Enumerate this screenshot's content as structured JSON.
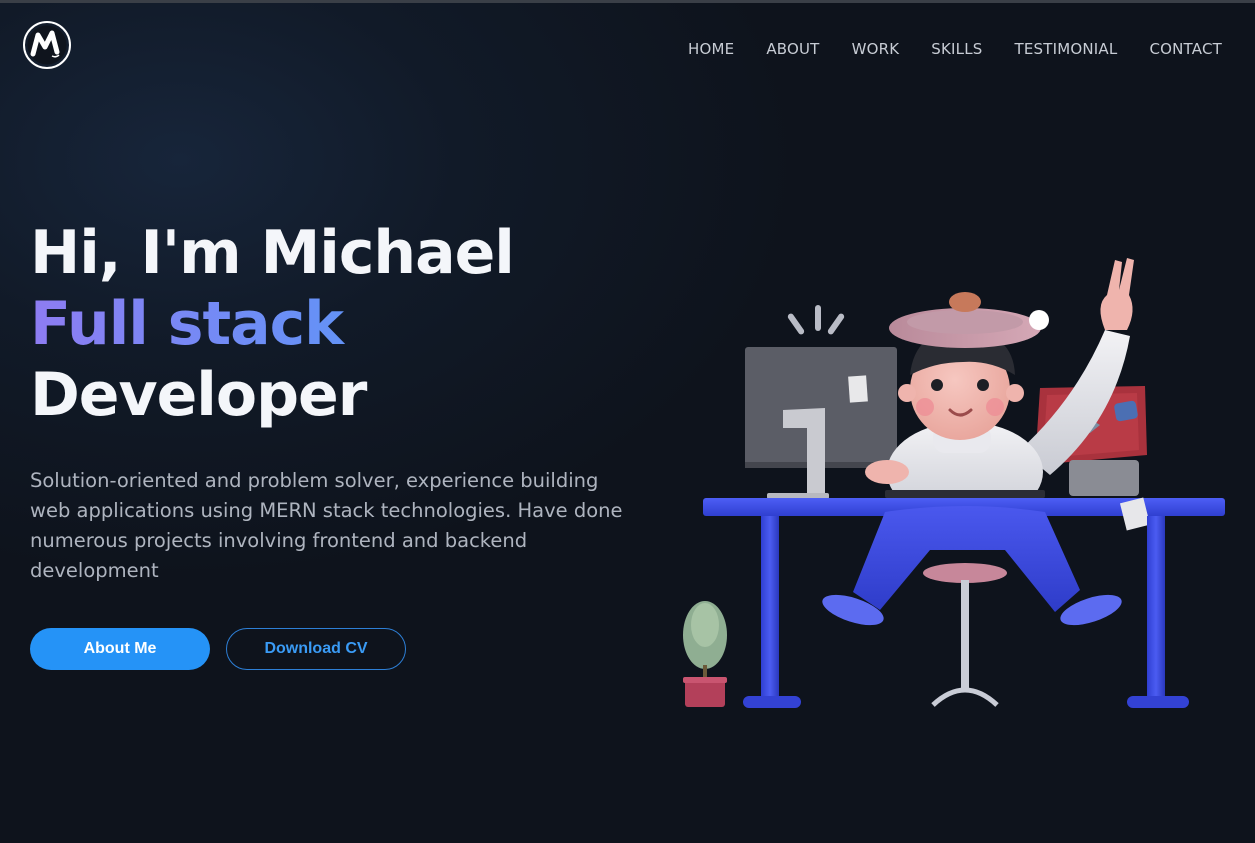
{
  "logo": {
    "icon": "m-logo-icon",
    "letter": "M"
  },
  "nav": {
    "items": [
      {
        "label": "HOME"
      },
      {
        "label": "ABOUT"
      },
      {
        "label": "WORK"
      },
      {
        "label": "SKILLS"
      },
      {
        "label": "TESTIMONIAL"
      },
      {
        "label": "CONTACT"
      }
    ]
  },
  "hero": {
    "line1": "Hi, I'm Michael",
    "line2": "Full stack",
    "line3": "Developer",
    "description": "Solution-oriented and problem solver, experience building web applications using MERN stack technologies. Have done numerous projects involving frontend and backend development",
    "primary_button": "About Me",
    "secondary_button": "Download CV"
  },
  "colors": {
    "accent_blue": "#2593f7",
    "gradient_start": "#8e7cf2",
    "gradient_end": "#4f9bf7",
    "nav_text": "#c7ccd4",
    "background": "#0f141d"
  },
  "illustration": {
    "subject": "developer-character-at-desk-illustration"
  }
}
